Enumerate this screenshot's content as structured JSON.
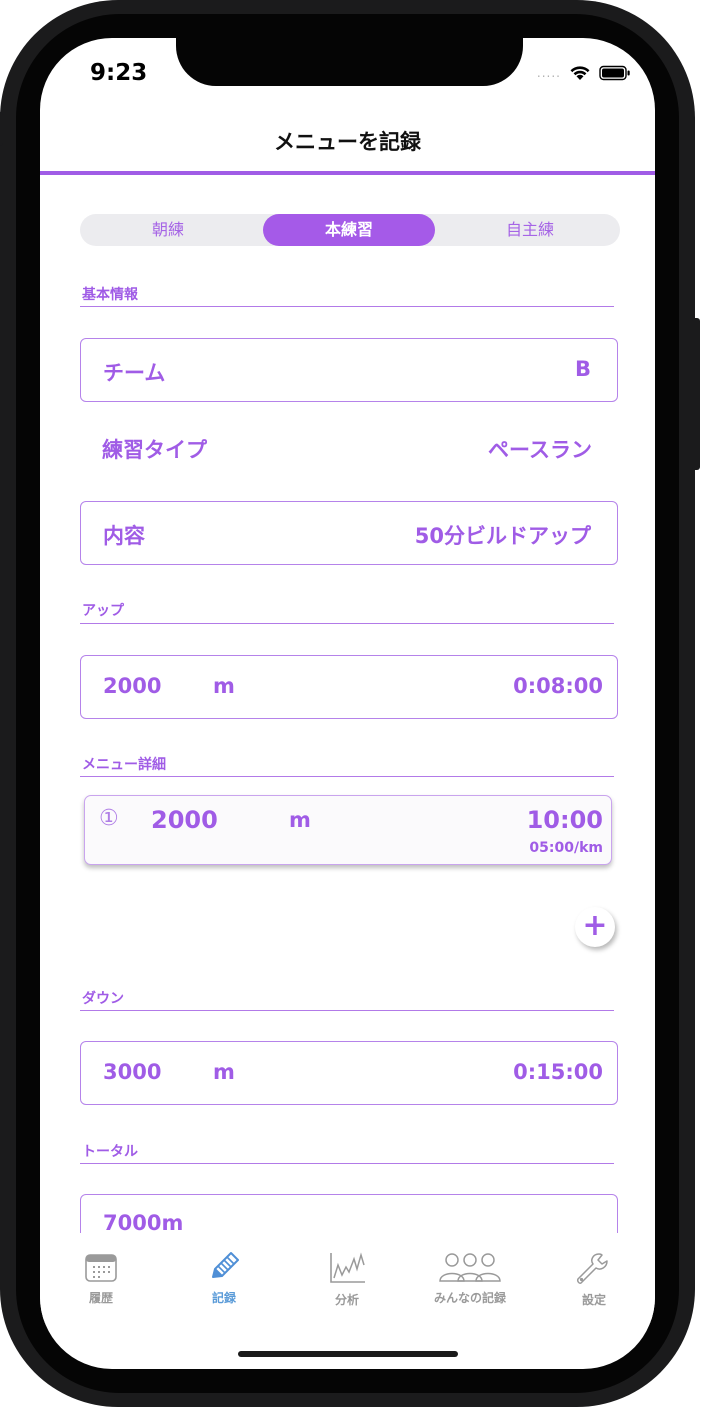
{
  "status_bar": {
    "time": "9:23",
    "cell_signal": "....."
  },
  "header": {
    "title": "メニューを記録"
  },
  "segments": [
    {
      "label": "朝練",
      "selected": false
    },
    {
      "label": "本練習",
      "selected": true
    },
    {
      "label": "自主練",
      "selected": false
    }
  ],
  "basic_info": {
    "section_label": "基本情報",
    "team": {
      "label": "チーム",
      "value": "B"
    },
    "practice_type": {
      "label": "練習タイプ",
      "value": "ペースラン"
    },
    "content": {
      "label": "内容",
      "value": "50分ビルドアップ"
    }
  },
  "up": {
    "section_label": "アップ",
    "distance": "2000",
    "unit": "m",
    "time": "0:08:00"
  },
  "menu_detail": {
    "section_label": "メニュー詳細",
    "items": [
      {
        "index": "①",
        "distance": "2000",
        "unit": "m",
        "time": "10:00",
        "pace": "05:00/km"
      }
    ],
    "add_label": "+"
  },
  "down": {
    "section_label": "ダウン",
    "distance": "3000",
    "unit": "m",
    "time": "0:15:00"
  },
  "total": {
    "section_label": "トータル",
    "value": "7000m"
  },
  "tabbar": {
    "items": [
      {
        "label": "履歴",
        "icon": "calendar-icon",
        "active": false
      },
      {
        "label": "記録",
        "icon": "pencil-icon",
        "active": true
      },
      {
        "label": "分析",
        "icon": "chart-icon",
        "active": false
      },
      {
        "label": "みんなの記録",
        "icon": "people-icon",
        "active": false
      },
      {
        "label": "設定",
        "icon": "wrench-icon",
        "active": false
      }
    ]
  },
  "colors": {
    "accent": "#a05ce6",
    "tab_active": "#5a9bd8",
    "tab_inactive": "#9a9a9a"
  }
}
